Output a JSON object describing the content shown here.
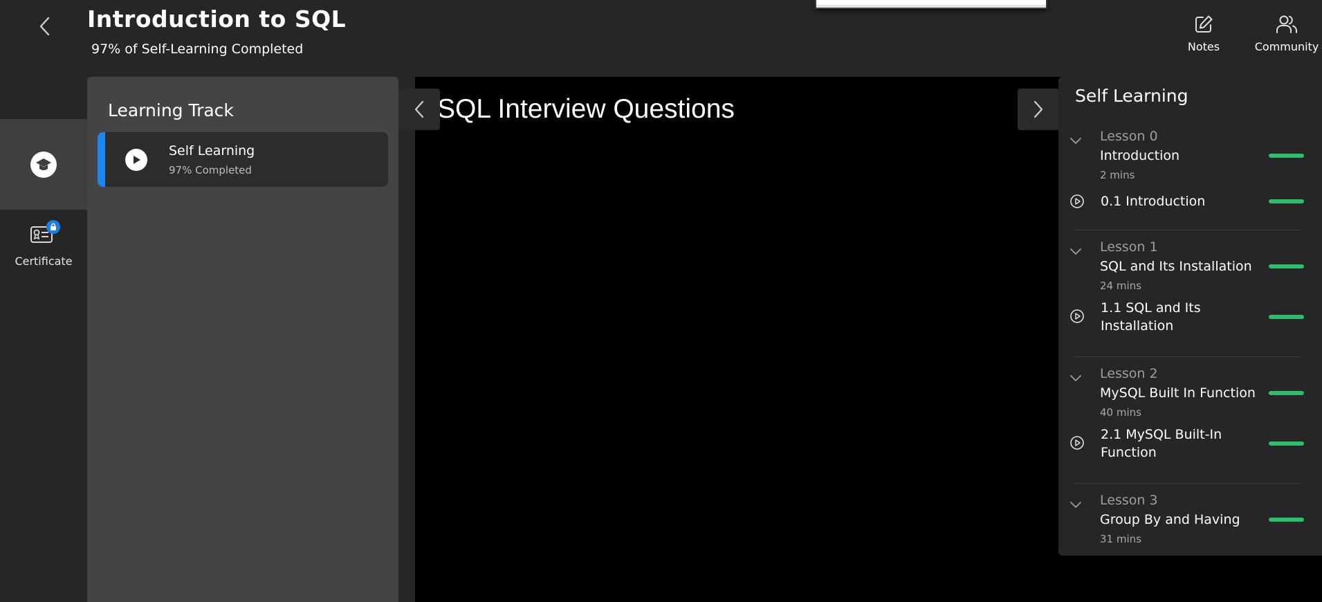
{
  "header": {
    "title": "Introduction to SQL",
    "progress_text": "97% of Self-Learning Completed",
    "notes_label": "Notes",
    "community_label": "Community"
  },
  "rail": {
    "certificate_label": "Certificate"
  },
  "track": {
    "title": "Learning Track",
    "item": {
      "name": "Self Learning",
      "progress": "97% Completed"
    }
  },
  "video": {
    "title": "SQL Interview Questions"
  },
  "self_learning": {
    "title": "Self Learning",
    "lessons": [
      {
        "number": "Lesson 0",
        "title": "Introduction",
        "duration": "2 mins",
        "completion": 1.0,
        "sub": {
          "title": "0.1 Introduction",
          "completion": 1.0
        }
      },
      {
        "number": "Lesson 1",
        "title": "SQL and Its Installation",
        "duration": "24 mins",
        "completion": 1.0,
        "sub": {
          "title": "1.1 SQL and Its Installation",
          "completion": 1.0
        }
      },
      {
        "number": "Lesson 2",
        "title": "MySQL Built In Function",
        "duration": "40 mins",
        "completion": 1.0,
        "sub": {
          "title": "2.1 MySQL Built-In Function",
          "completion": 1.0
        }
      },
      {
        "number": "Lesson 3",
        "title": "Group By and Having",
        "duration": "31 mins",
        "completion": 1.0
      }
    ]
  },
  "colors": {
    "background": "#262626",
    "panel": "#444444",
    "accent_blue": "#1a86f0",
    "progress_green": "#2ebd6b"
  }
}
